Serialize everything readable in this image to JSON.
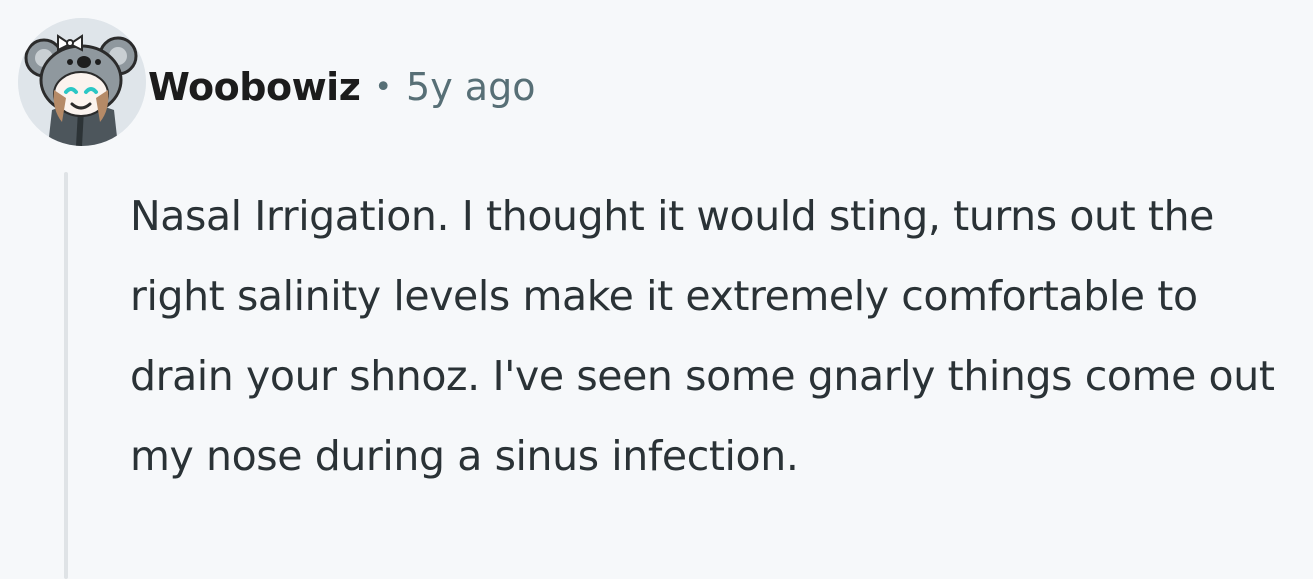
{
  "comment": {
    "username": "Woobowiz",
    "separator": "•",
    "age": "5y ago",
    "body": "Nasal Irrigation. I thought it would sting, turns out the right salinity levels make it extremely comfortable to drain your shnoz. I've seen some gnarly things come out my nose during a sinus infection."
  },
  "icons": {
    "avatar": "koala-hood-avatar-icon"
  }
}
